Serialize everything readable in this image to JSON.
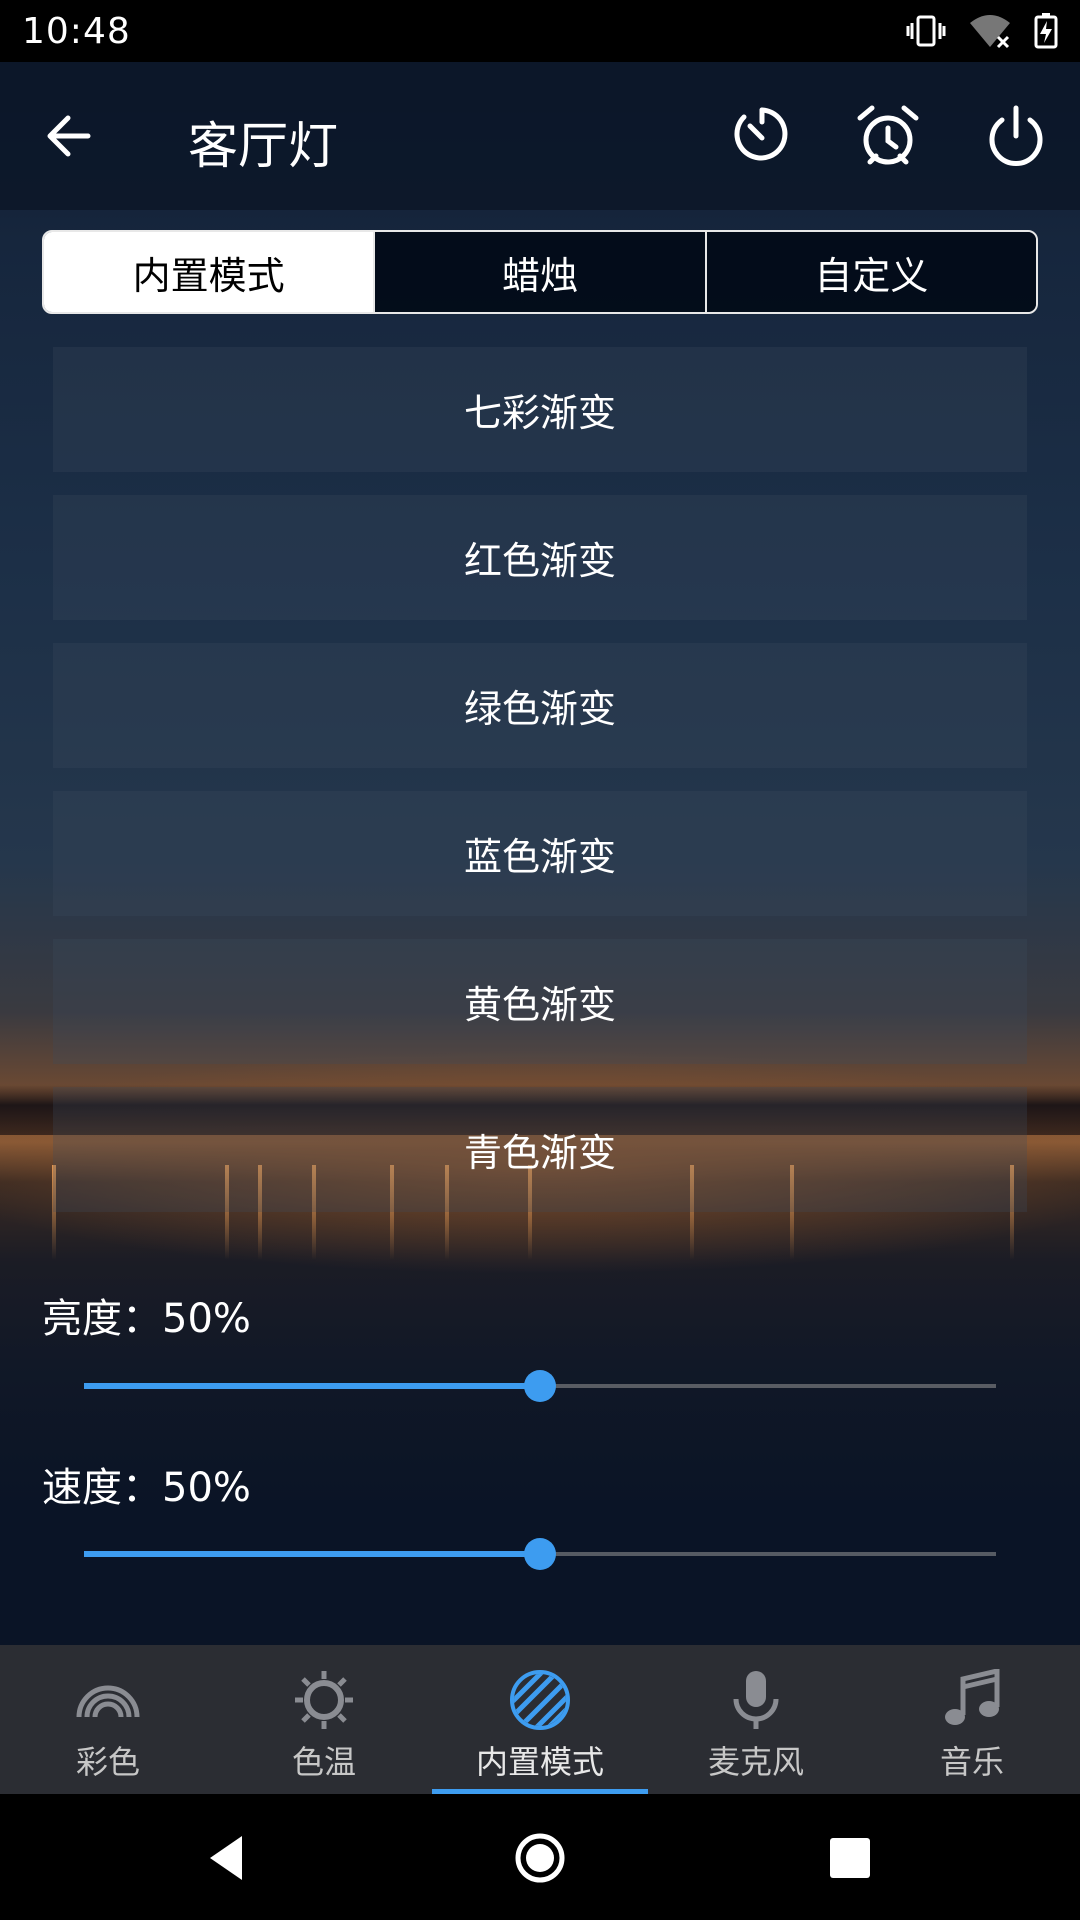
{
  "status_bar": {
    "time": "10:48"
  },
  "app_bar": {
    "title": "客厅灯"
  },
  "tabs": [
    {
      "label": "内置模式",
      "active": true
    },
    {
      "label": "蜡烛",
      "active": false
    },
    {
      "label": "自定义",
      "active": false
    }
  ],
  "modes": [
    {
      "label": "七彩渐变"
    },
    {
      "label": "红色渐变"
    },
    {
      "label": "绿色渐变"
    },
    {
      "label": "蓝色渐变"
    },
    {
      "label": "黄色渐变"
    },
    {
      "label": "青色渐变"
    }
  ],
  "brightness": {
    "label": "亮度：50%",
    "value": 0.5
  },
  "speed": {
    "label": "速度：50%",
    "value": 0.5
  },
  "bottom_nav": [
    {
      "label": "彩色",
      "icon": "rainbow-icon",
      "active": false
    },
    {
      "label": "色温",
      "icon": "sun-icon",
      "active": false
    },
    {
      "label": "内置模式",
      "icon": "striped-circle-icon",
      "active": true
    },
    {
      "label": "麦克风",
      "icon": "microphone-icon",
      "active": false
    },
    {
      "label": "音乐",
      "icon": "music-note-icon",
      "active": false
    }
  ],
  "colors": {
    "accent": "#3d9cf0",
    "nav_bg": "#2b2d33",
    "app_bar_bg": "#0c1628"
  }
}
